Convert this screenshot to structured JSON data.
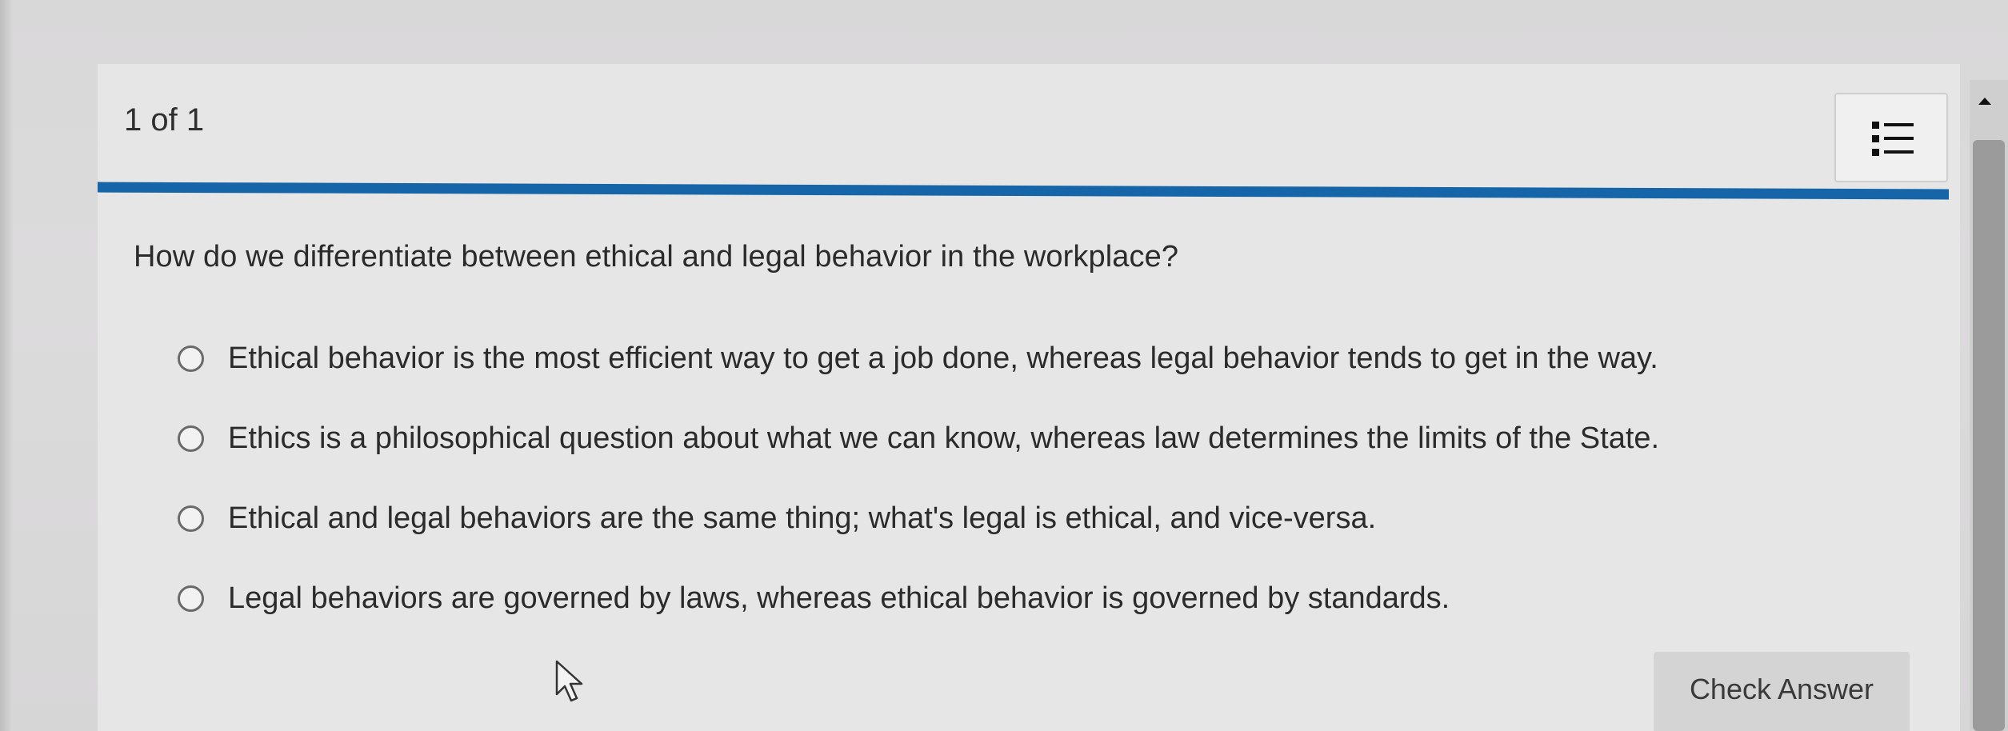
{
  "header": {
    "progress_text": "1 of 1"
  },
  "question": {
    "text": "How do we differentiate between ethical and legal behavior in the workplace?",
    "options": [
      {
        "label": "Ethical behavior is the most efficient way to get a job done, whereas legal behavior tends to get in the way."
      },
      {
        "label": "Ethics is a philosophical question about what we can know, whereas law determines the limits of the State."
      },
      {
        "label": "Ethical and legal behaviors are the same thing; what's legal is ethical, and vice-versa."
      },
      {
        "label": "Legal behaviors are governed by laws, whereas ethical behavior is governed by standards."
      }
    ]
  },
  "actions": {
    "check_answer_label": "Check Answer"
  },
  "icons": {
    "menu": "list-icon",
    "cursor": "mouse-pointer-icon",
    "scroll_up": "scroll-up-arrow-icon"
  },
  "colors": {
    "accent_rule": "#1565a8",
    "panel_background": "#e6e6e6",
    "button_background": "#d4d4d4"
  }
}
